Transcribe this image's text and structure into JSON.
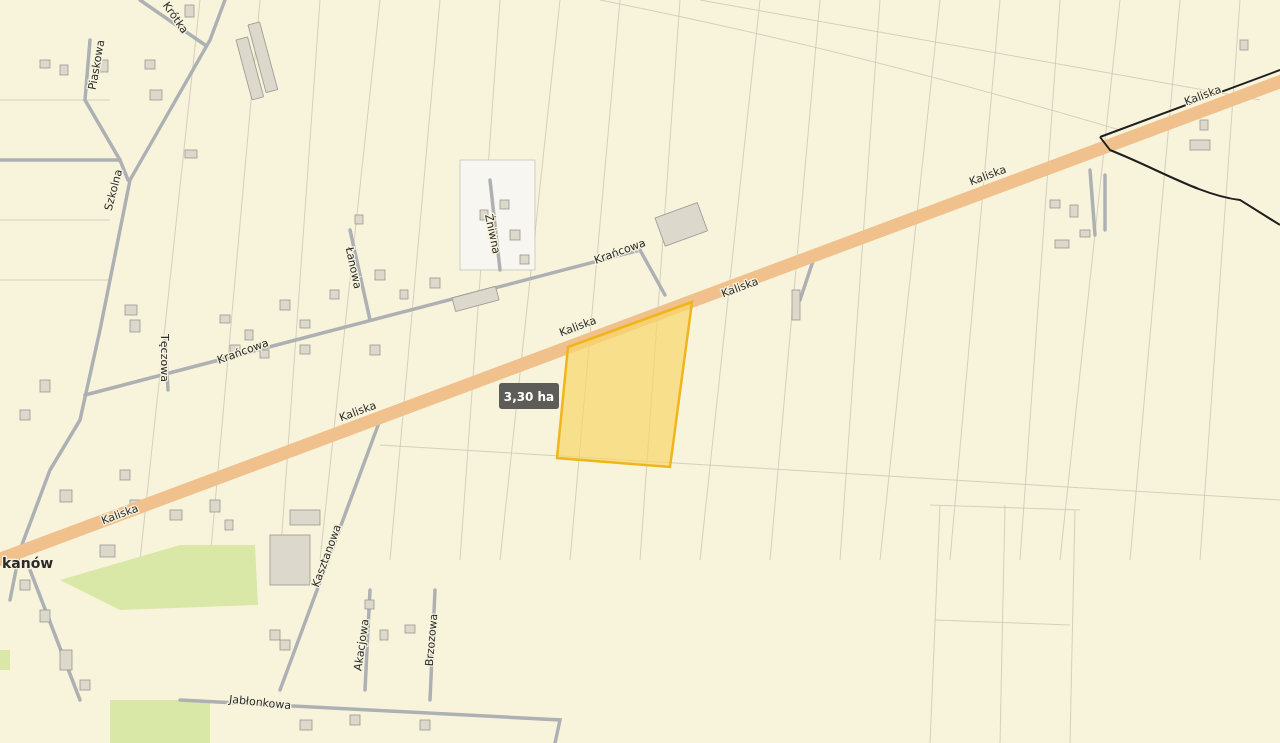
{
  "map": {
    "street_labels": [
      {
        "text": "Krótka"
      },
      {
        "text": "Piaskowa"
      },
      {
        "text": "Szkolna"
      },
      {
        "text": "Łanowa"
      },
      {
        "text": "Żniwna"
      },
      {
        "text": "Krańcowa"
      },
      {
        "text": "Tęczowa"
      },
      {
        "text": "Krańcowa"
      },
      {
        "text": "Kaliska"
      },
      {
        "text": "Kaliska"
      },
      {
        "text": "Kaliska"
      },
      {
        "text": "Kaliska"
      },
      {
        "text": "Kaliska"
      },
      {
        "text": "Kaliska"
      },
      {
        "text": "Kasztanowa"
      },
      {
        "text": "Akacjowa"
      },
      {
        "text": "Brzozowa"
      },
      {
        "text": "Jabłonkowa"
      }
    ],
    "place_label": "kanów",
    "parcel": {
      "area": "3,30 ha"
    }
  }
}
